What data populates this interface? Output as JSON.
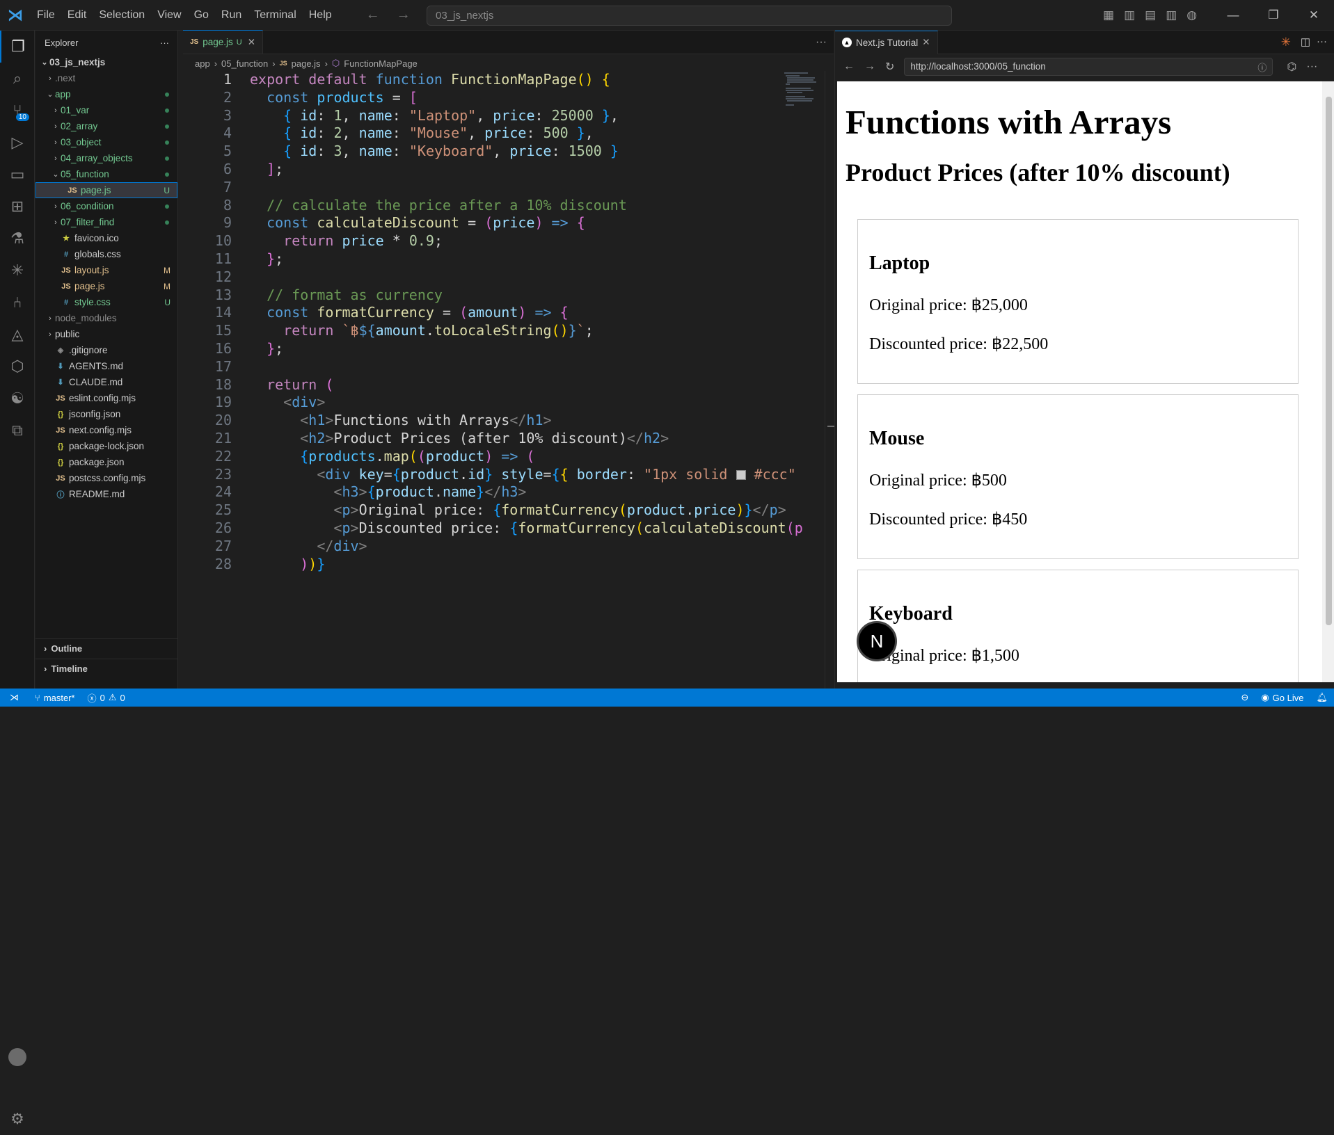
{
  "titlebar": {
    "menu": [
      "File",
      "Edit",
      "Selection",
      "View",
      "Go",
      "Run",
      "Terminal",
      "Help"
    ],
    "search": "03_js_nextjs"
  },
  "explorer": {
    "title": "Explorer",
    "root": "03_js_nextjs",
    "items": [
      {
        "label": ".next",
        "type": "folder",
        "depth": 1,
        "open": false,
        "color": "dim",
        "status": ""
      },
      {
        "label": "app",
        "type": "folder",
        "depth": 1,
        "open": true,
        "color": "g",
        "status": "dot"
      },
      {
        "label": "01_var",
        "type": "folder",
        "depth": 2,
        "open": false,
        "color": "g",
        "status": "dot"
      },
      {
        "label": "02_array",
        "type": "folder",
        "depth": 2,
        "open": false,
        "color": "g",
        "status": "dot"
      },
      {
        "label": "03_object",
        "type": "folder",
        "depth": 2,
        "open": false,
        "color": "g",
        "status": "dot"
      },
      {
        "label": "04_array_objects",
        "type": "folder",
        "depth": 2,
        "open": false,
        "color": "g",
        "status": "dot"
      },
      {
        "label": "05_function",
        "type": "folder",
        "depth": 2,
        "open": true,
        "color": "g",
        "status": "dot"
      },
      {
        "label": "page.js",
        "type": "js",
        "depth": 3,
        "color": "g",
        "status": "U",
        "selected": true
      },
      {
        "label": "06_condition",
        "type": "folder",
        "depth": 2,
        "open": false,
        "color": "g",
        "status": "dot"
      },
      {
        "label": "07_filter_find",
        "type": "folder",
        "depth": 2,
        "open": false,
        "color": "g",
        "status": "dot"
      },
      {
        "label": "favicon.ico",
        "type": "star",
        "depth": 2,
        "color": "",
        "status": ""
      },
      {
        "label": "globals.css",
        "type": "css",
        "depth": 2,
        "color": "",
        "status": ""
      },
      {
        "label": "layout.js",
        "type": "js",
        "depth": 2,
        "color": "y",
        "status": "M"
      },
      {
        "label": "page.js",
        "type": "js",
        "depth": 2,
        "color": "y",
        "status": "M"
      },
      {
        "label": "style.css",
        "type": "css",
        "depth": 2,
        "color": "g",
        "status": "U"
      },
      {
        "label": "node_modules",
        "type": "folder",
        "depth": 1,
        "open": false,
        "color": "dim",
        "status": ""
      },
      {
        "label": "public",
        "type": "folder",
        "depth": 1,
        "open": false,
        "color": "",
        "status": ""
      },
      {
        "label": ".gitignore",
        "type": "git",
        "depth": 1,
        "color": "",
        "status": ""
      },
      {
        "label": "AGENTS.md",
        "type": "md",
        "depth": 1,
        "color": "",
        "status": ""
      },
      {
        "label": "CLAUDE.md",
        "type": "md",
        "depth": 1,
        "color": "",
        "status": ""
      },
      {
        "label": "eslint.config.mjs",
        "type": "js",
        "depth": 1,
        "color": "",
        "status": ""
      },
      {
        "label": "jsconfig.json",
        "type": "json",
        "depth": 1,
        "color": "",
        "status": ""
      },
      {
        "label": "next.config.mjs",
        "type": "js",
        "depth": 1,
        "color": "",
        "status": ""
      },
      {
        "label": "package-lock.json",
        "type": "json",
        "depth": 1,
        "color": "",
        "status": ""
      },
      {
        "label": "package.json",
        "type": "json",
        "depth": 1,
        "color": "",
        "status": ""
      },
      {
        "label": "postcss.config.mjs",
        "type": "js",
        "depth": 1,
        "color": "",
        "status": ""
      },
      {
        "label": "README.md",
        "type": "info",
        "depth": 1,
        "color": "",
        "status": ""
      }
    ],
    "outline": "Outline",
    "timeline": "Timeline"
  },
  "editor": {
    "tab": {
      "label": "page.js",
      "status": "U"
    },
    "breadcrumb": [
      "app",
      "05_function",
      "page.js",
      "FunctionMapPage"
    ],
    "current_line": 1
  },
  "preview": {
    "tab": "Next.js Tutorial",
    "url": "http://localhost:3000/05_function",
    "h1": "Functions with Arrays",
    "h2": "Product Prices (after 10% discount)",
    "cards": [
      {
        "name": "Laptop",
        "original": "Original price: ฿25,000",
        "discounted": "Discounted price: ฿22,500"
      },
      {
        "name": "Mouse",
        "original": "Original price: ฿500",
        "discounted": "Discounted price: ฿450"
      },
      {
        "name": "Keyboard",
        "original": "Original price: ฿1,500",
        "discounted": ""
      }
    ],
    "next_badge": "N"
  },
  "statusbar": {
    "branch": "master*",
    "errors": "0",
    "warnings": "0",
    "golive": "Go Live"
  }
}
